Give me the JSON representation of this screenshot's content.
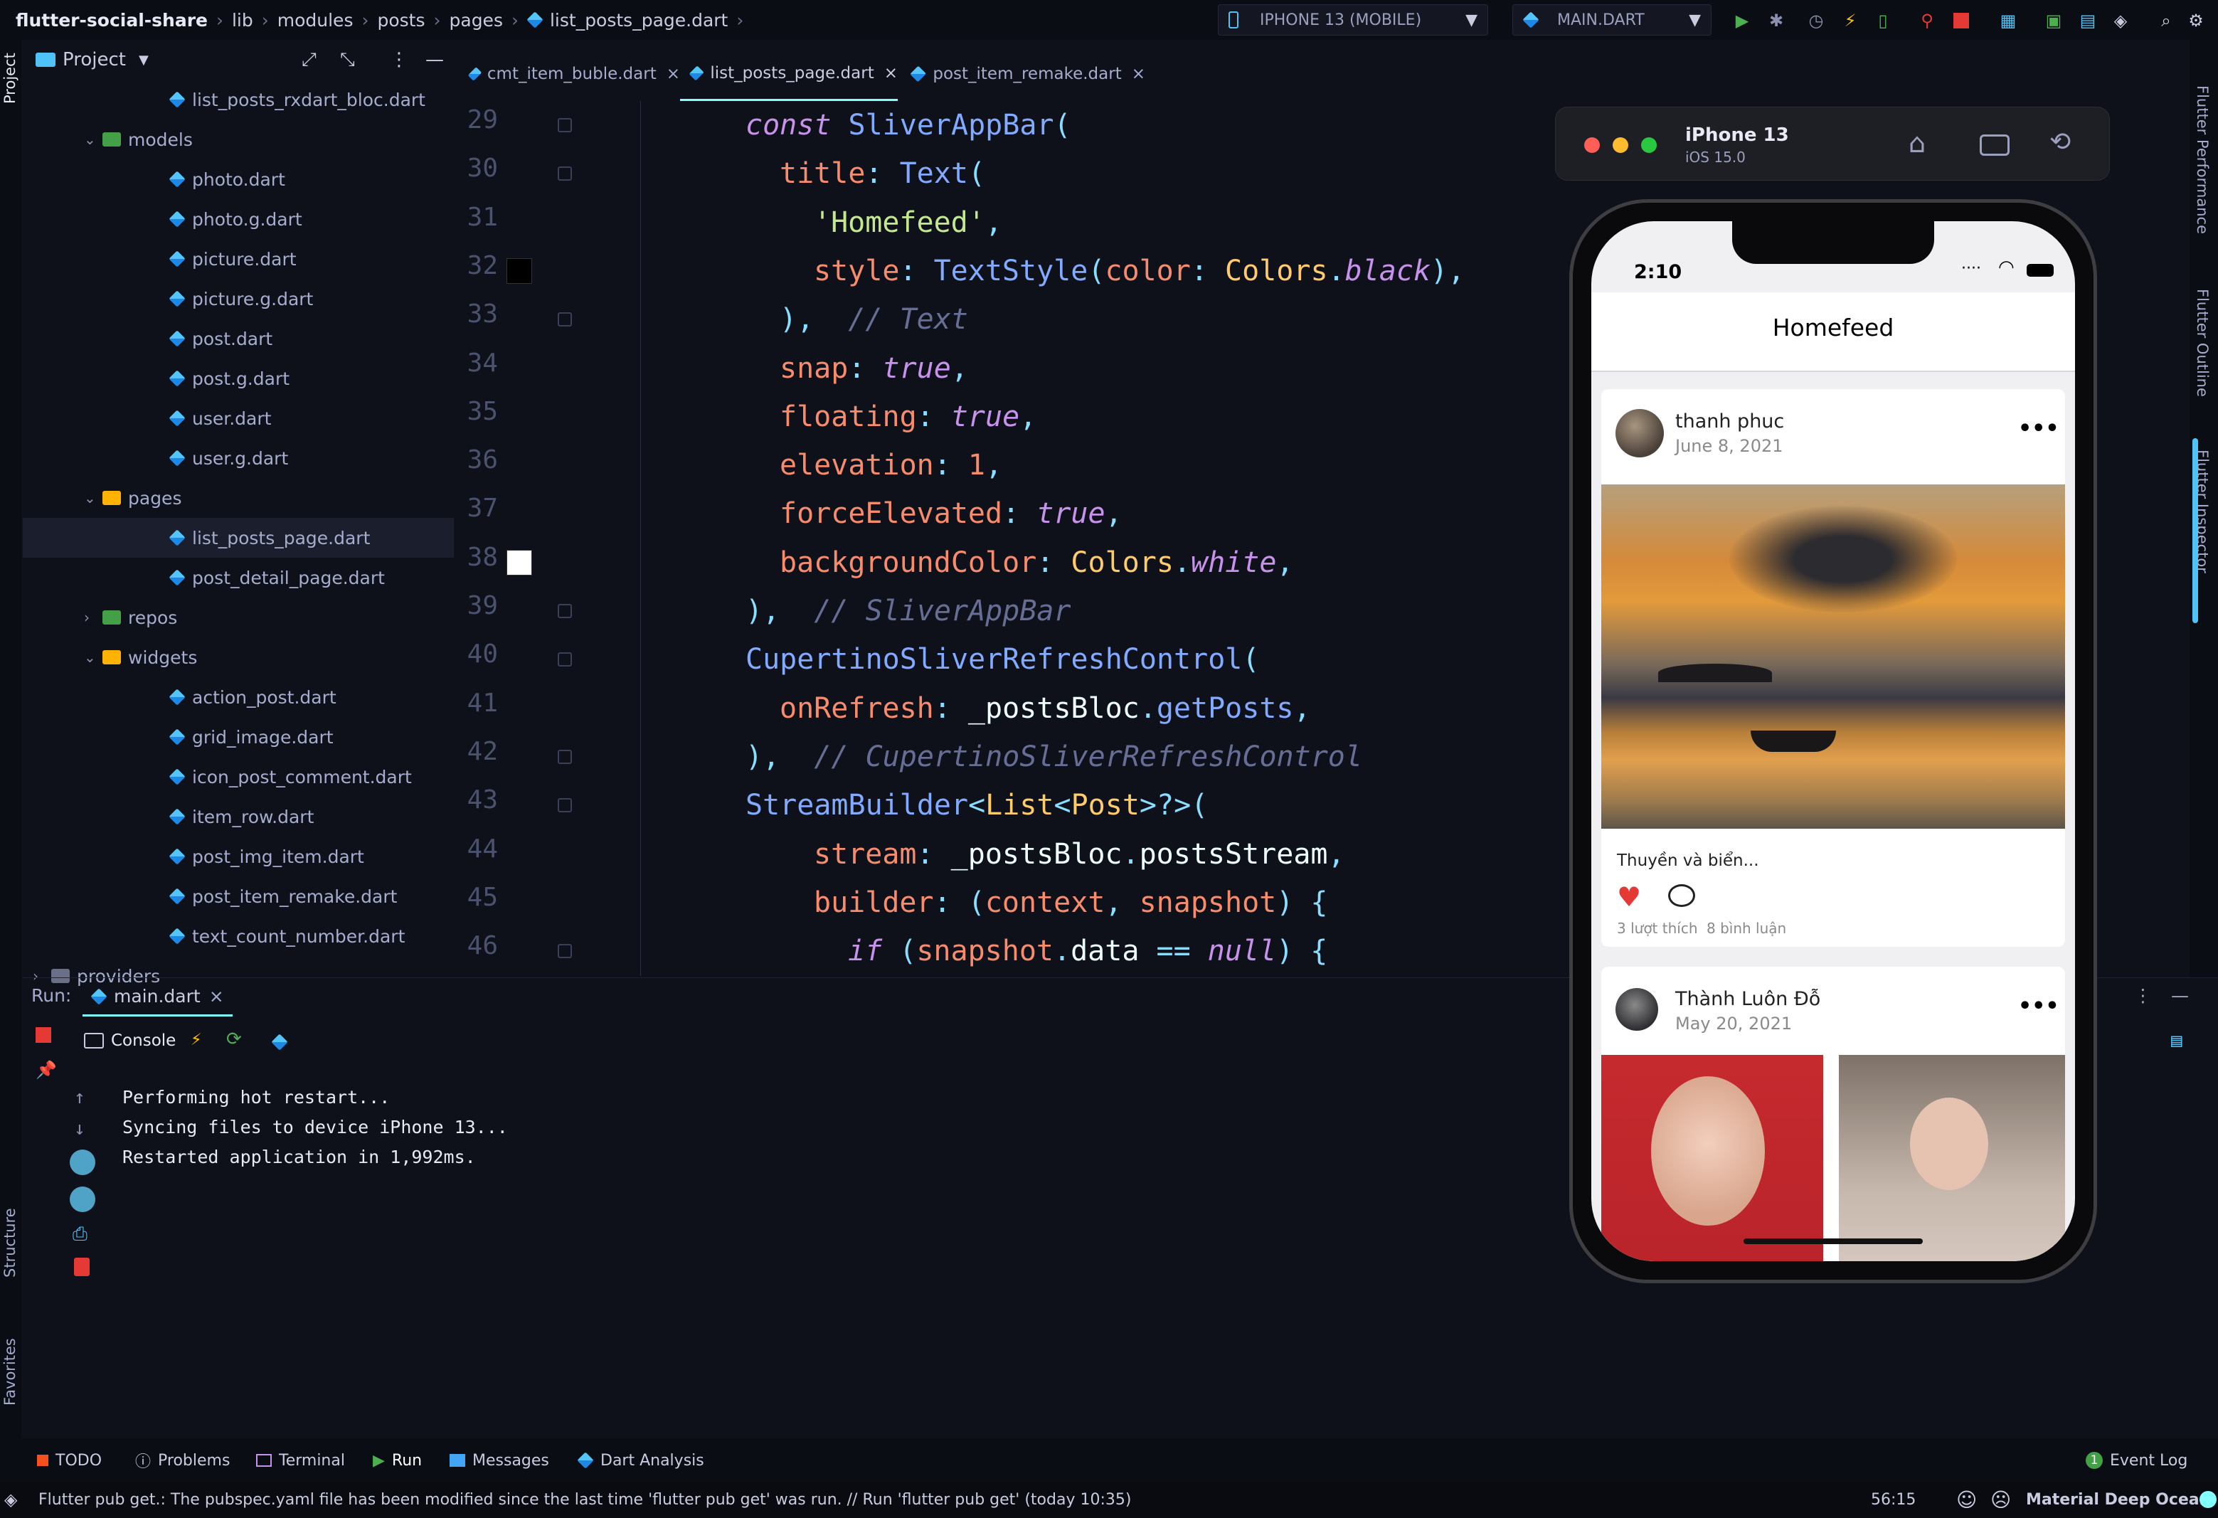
{
  "navbar": {
    "breadcrumb": [
      "flutter-social-share",
      "lib",
      "modules",
      "posts",
      "pages",
      "list_posts_page.dart"
    ],
    "device": "IPHONE 13 (MOBILE)",
    "run_config": "MAIN.DART"
  },
  "left_tools": {
    "project": "Project",
    "structure": "Structure",
    "favorites": "Favorites"
  },
  "project_panel": {
    "title": "Project",
    "items": [
      {
        "label": "list_posts_rxdart_bloc.dart",
        "type": "dart",
        "indent": 3
      },
      {
        "label": "models",
        "type": "folder",
        "indent": 2,
        "open": true
      },
      {
        "label": "photo.dart",
        "type": "dart",
        "indent": 3
      },
      {
        "label": "photo.g.dart",
        "type": "dart",
        "indent": 3
      },
      {
        "label": "picture.dart",
        "type": "dart",
        "indent": 3
      },
      {
        "label": "picture.g.dart",
        "type": "dart",
        "indent": 3
      },
      {
        "label": "post.dart",
        "type": "dart",
        "indent": 3
      },
      {
        "label": "post.g.dart",
        "type": "dart",
        "indent": 3
      },
      {
        "label": "user.dart",
        "type": "dart",
        "indent": 3
      },
      {
        "label": "user.g.dart",
        "type": "dart",
        "indent": 3
      },
      {
        "label": "pages",
        "type": "folder",
        "indent": 2,
        "open": true
      },
      {
        "label": "list_posts_page.dart",
        "type": "dart",
        "indent": 3,
        "selected": true
      },
      {
        "label": "post_detail_page.dart",
        "type": "dart",
        "indent": 3
      },
      {
        "label": "repos",
        "type": "folder",
        "indent": 2,
        "open": false
      },
      {
        "label": "widgets",
        "type": "folder",
        "indent": 2,
        "open": true
      },
      {
        "label": "action_post.dart",
        "type": "dart",
        "indent": 3
      },
      {
        "label": "grid_image.dart",
        "type": "dart",
        "indent": 3
      },
      {
        "label": "icon_post_comment.dart",
        "type": "dart",
        "indent": 3
      },
      {
        "label": "item_row.dart",
        "type": "dart",
        "indent": 3
      },
      {
        "label": "post_img_item.dart",
        "type": "dart",
        "indent": 3
      },
      {
        "label": "post_item_remake.dart",
        "type": "dart",
        "indent": 3
      },
      {
        "label": "text_count_number.dart",
        "type": "dart",
        "indent": 3
      },
      {
        "label": "providers",
        "type": "folder",
        "indent": 1,
        "open": false
      }
    ]
  },
  "editor_tabs": [
    {
      "label": "cmt_item_buble.dart",
      "active": false
    },
    {
      "label": "list_posts_page.dart",
      "active": true
    },
    {
      "label": "post_item_remake.dart",
      "active": false
    }
  ],
  "line_numbers": [
    "29",
    "30",
    "31",
    "32",
    "33",
    "34",
    "35",
    "36",
    "37",
    "38",
    "39",
    "40",
    "41",
    "42",
    "43",
    "44",
    "45",
    "46"
  ],
  "code_lines": [
    {
      "indent": 0,
      "tokens": [
        [
          "kw",
          "const "
        ],
        [
          "cls",
          "SliverAppBar"
        ],
        [
          "pu",
          "("
        ]
      ]
    },
    {
      "indent": 1,
      "tokens": [
        [
          "prop",
          "title"
        ],
        [
          "pu",
          ": "
        ],
        [
          "cls",
          "Text"
        ],
        [
          "pu",
          "("
        ]
      ]
    },
    {
      "indent": 2,
      "tokens": [
        [
          "str",
          "'Homefeed'"
        ],
        [
          "pu",
          ","
        ]
      ]
    },
    {
      "indent": 2,
      "tokens": [
        [
          "prop",
          "style"
        ],
        [
          "pu",
          ": "
        ],
        [
          "cls",
          "TextStyle"
        ],
        [
          "pu",
          "("
        ],
        [
          "prop",
          "color"
        ],
        [
          "pu",
          ": "
        ],
        [
          "ty",
          "Colors"
        ],
        [
          "pu",
          "."
        ],
        [
          "bo",
          "black"
        ],
        [
          "pu",
          "),"
        ]
      ]
    },
    {
      "indent": 1,
      "tokens": [
        [
          "pu",
          "),  "
        ],
        [
          "cm",
          "// Text"
        ]
      ]
    },
    {
      "indent": 1,
      "tokens": [
        [
          "prop",
          "snap"
        ],
        [
          "pu",
          ": "
        ],
        [
          "kw",
          "true"
        ],
        [
          "pu",
          ","
        ]
      ]
    },
    {
      "indent": 1,
      "tokens": [
        [
          "prop",
          "floating"
        ],
        [
          "pu",
          ": "
        ],
        [
          "kw",
          "true"
        ],
        [
          "pu",
          ","
        ]
      ]
    },
    {
      "indent": 1,
      "tokens": [
        [
          "prop",
          "elevation"
        ],
        [
          "pu",
          ": "
        ],
        [
          "prop",
          "1"
        ],
        [
          "pu",
          ","
        ]
      ]
    },
    {
      "indent": 1,
      "tokens": [
        [
          "prop",
          "forceElevated"
        ],
        [
          "pu",
          ": "
        ],
        [
          "kw",
          "true"
        ],
        [
          "pu",
          ","
        ]
      ]
    },
    {
      "indent": 1,
      "tokens": [
        [
          "prop",
          "backgroundColor"
        ],
        [
          "pu",
          ": "
        ],
        [
          "ty",
          "Colors"
        ],
        [
          "pu",
          "."
        ],
        [
          "bo",
          "white"
        ],
        [
          "pu",
          ","
        ]
      ]
    },
    {
      "indent": 0,
      "tokens": [
        [
          "pu",
          "),  "
        ],
        [
          "cm",
          "// SliverAppBar"
        ]
      ]
    },
    {
      "indent": 0,
      "tokens": [
        [
          "cls",
          "CupertinoSliverRefreshControl"
        ],
        [
          "pu",
          "("
        ]
      ]
    },
    {
      "indent": 1,
      "tokens": [
        [
          "prop",
          "onRefresh"
        ],
        [
          "pu",
          ": "
        ],
        [
          "pl",
          "_postsBloc"
        ],
        [
          "pu",
          "."
        ],
        [
          "cls",
          "getPosts"
        ],
        [
          "pu",
          ","
        ]
      ]
    },
    {
      "indent": 0,
      "tokens": [
        [
          "pu",
          "),  "
        ],
        [
          "cm",
          "// CupertinoSliverRefreshControl"
        ]
      ]
    },
    {
      "indent": 0,
      "tokens": [
        [
          "cls",
          "StreamBuilder"
        ],
        [
          "pu",
          "<"
        ],
        [
          "ty",
          "List"
        ],
        [
          "pu",
          "<"
        ],
        [
          "ty",
          "Post"
        ],
        [
          "pu",
          ">?>("
        ]
      ]
    },
    {
      "indent": 2,
      "tokens": [
        [
          "prop",
          "stream"
        ],
        [
          "pu",
          ": "
        ],
        [
          "pl",
          "_postsBloc"
        ],
        [
          "pu",
          "."
        ],
        [
          "pl",
          "postsStream"
        ],
        [
          "pu",
          ","
        ]
      ]
    },
    {
      "indent": 2,
      "tokens": [
        [
          "prop",
          "builder"
        ],
        [
          "pu",
          ": ("
        ],
        [
          "prop",
          "context"
        ],
        [
          "pu",
          ", "
        ],
        [
          "prop",
          "snapshot"
        ],
        [
          "pu",
          ") {"
        ]
      ]
    },
    {
      "indent": 3,
      "tokens": [
        [
          "kw",
          "if "
        ],
        [
          "pu",
          "("
        ],
        [
          "prop",
          "snapshot"
        ],
        [
          "pu",
          "."
        ],
        [
          "pl",
          "data"
        ],
        [
          "pu",
          " == "
        ],
        [
          "kw",
          "null"
        ],
        [
          "pu",
          ") {"
        ]
      ]
    }
  ],
  "run": {
    "label": "Run:",
    "tab": "main.dart",
    "console_tab": "Console",
    "output": [
      "Performing hot restart...",
      "Syncing files to device iPhone 13...",
      "Restarted application in 1,992ms."
    ]
  },
  "bottom_tools": [
    "TODO",
    "Problems",
    "Terminal",
    "Run",
    "Messages",
    "Dart Analysis"
  ],
  "event_log": {
    "count": "1",
    "label": "Event Log"
  },
  "status": {
    "message": "Flutter pub get.: The pubspec.yaml file has been modified since the last time 'flutter pub get' was run. // Run 'flutter pub get' (today 10:35)",
    "position": "56:15",
    "theme": "Material Deep Ocean"
  },
  "right_tools": [
    "Flutter Performance",
    "Flutter Outline",
    "Flutter Inspector"
  ],
  "simulator": {
    "device": "iPhone 13",
    "os": "iOS 15.0",
    "app": {
      "time": "2:10",
      "title": "Homefeed",
      "posts": [
        {
          "author": "thanh phuc",
          "date": "June 8, 2021",
          "caption": "Thuyền và biển...",
          "likes": "3 lượt thích",
          "comments": "8 bình luận"
        },
        {
          "author": "Thành Luôn Đỗ",
          "date": "May 20, 2021"
        }
      ]
    }
  },
  "colors": {
    "bg": "#0f111a",
    "accent": "#84ffff",
    "keyword": "#c792ea",
    "class": "#82aaff",
    "type": "#ffcb6b",
    "property": "#f78c6c",
    "string": "#c3e88d",
    "comment": "#676e95"
  }
}
